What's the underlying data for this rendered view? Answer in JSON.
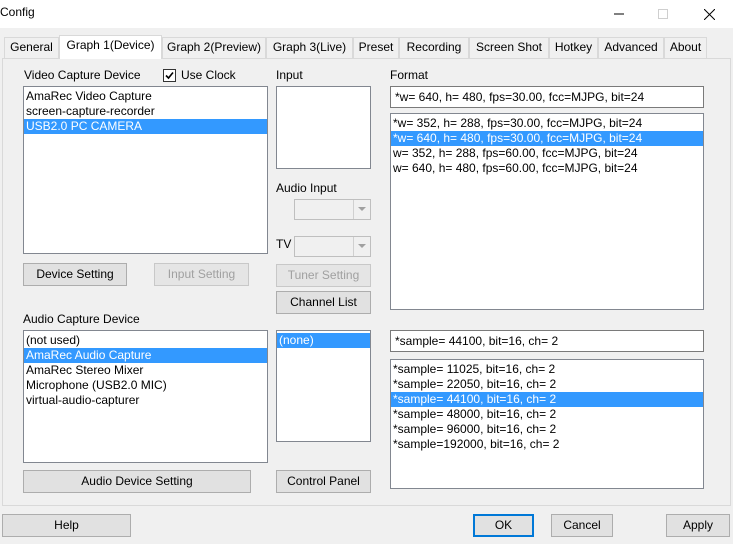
{
  "window": {
    "title": "Config"
  },
  "tabs": [
    {
      "label": "General"
    },
    {
      "label": "Graph 1(Device)"
    },
    {
      "label": "Graph 2(Preview)"
    },
    {
      "label": "Graph 3(Live)"
    },
    {
      "label": "Preset"
    },
    {
      "label": "Recording"
    },
    {
      "label": "Screen Shot"
    },
    {
      "label": "Hotkey"
    },
    {
      "label": "Advanced"
    },
    {
      "label": "About"
    }
  ],
  "video": {
    "label": "Video Capture Device",
    "use_clock_label": "Use Clock",
    "use_clock_checked": true,
    "devices": [
      {
        "label": "AmaRec Video Capture",
        "selected": false
      },
      {
        "label": "screen-capture-recorder",
        "selected": false
      },
      {
        "label": "USB2.0 PC CAMERA",
        "selected": true
      }
    ],
    "device_setting_label": "Device Setting",
    "input_setting_label": "Input Setting"
  },
  "input": {
    "label": "Input",
    "audio_input_label": "Audio Input",
    "tv_label": "TV",
    "tuner_setting_label": "Tuner Setting",
    "channel_list_label": "Channel List"
  },
  "format": {
    "label": "Format",
    "current": "*w= 640, h= 480, fps=30.00,  fcc=MJPG, bit=24",
    "options": [
      {
        "label": "*w= 352, h= 288, fps=30.00,  fcc=MJPG, bit=24",
        "selected": false
      },
      {
        "label": "*w= 640, h= 480, fps=30.00,  fcc=MJPG, bit=24",
        "selected": true
      },
      {
        "label": "w= 352, h= 288, fps=60.00,  fcc=MJPG, bit=24",
        "selected": false
      },
      {
        "label": "w= 640, h= 480, fps=60.00,  fcc=MJPG, bit=24",
        "selected": false
      }
    ]
  },
  "audio": {
    "label": "Audio Capture Device",
    "devices": [
      {
        "label": "(not used)",
        "selected": false
      },
      {
        "label": "AmaRec Audio Capture",
        "selected": true
      },
      {
        "label": "AmaRec Stereo Mixer",
        "selected": false
      },
      {
        "label": "Microphone (USB2.0 MIC)",
        "selected": false
      },
      {
        "label": "virtual-audio-capturer",
        "selected": false
      }
    ],
    "input_options": [
      {
        "label": "(none)",
        "selected": true
      }
    ],
    "audio_device_setting_label": "Audio Device Setting",
    "control_panel_label": "Control Panel",
    "current_format": "*sample= 44100, bit=16, ch= 2",
    "formats": [
      {
        "label": "*sample= 11025, bit=16, ch= 2",
        "selected": false
      },
      {
        "label": "*sample= 22050, bit=16, ch= 2",
        "selected": false
      },
      {
        "label": "*sample= 44100, bit=16, ch= 2",
        "selected": true
      },
      {
        "label": "*sample= 48000, bit=16, ch= 2",
        "selected": false
      },
      {
        "label": "*sample= 96000, bit=16, ch= 2",
        "selected": false
      },
      {
        "label": "*sample=192000, bit=16, ch= 2",
        "selected": false
      }
    ]
  },
  "footer": {
    "help_label": "Help",
    "ok_label": "OK",
    "cancel_label": "Cancel",
    "apply_label": "Apply"
  }
}
